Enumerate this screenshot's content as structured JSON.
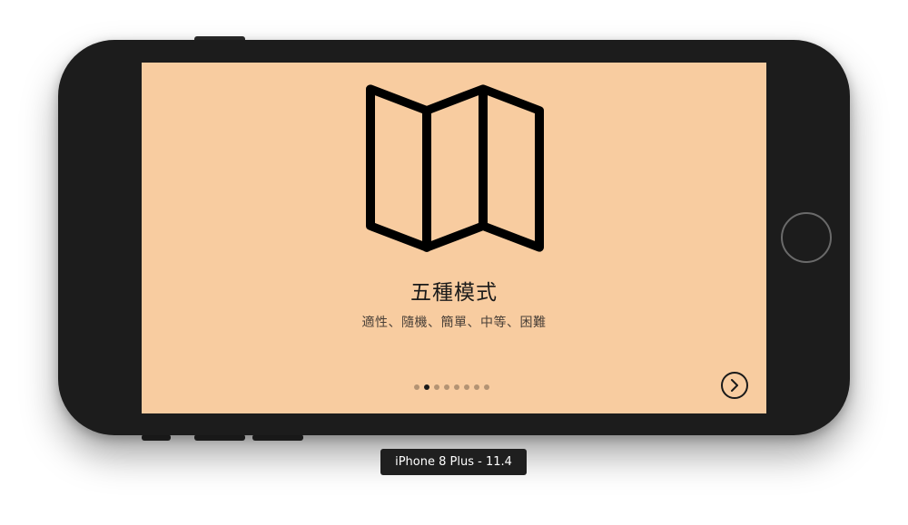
{
  "device": {
    "label": "iPhone 8 Plus - 11.4"
  },
  "onboarding": {
    "title": "五種模式",
    "subtitle": "適性、隨機、簡單、中等、困難",
    "hero_icon": "folded-map-icon",
    "page_count": 8,
    "current_page": 2,
    "next_icon": "chevron-right-circle-icon"
  },
  "colors": {
    "screen_background": "#f8cca0",
    "device_body": "#1c1c1c",
    "foreground": "#1a1a1a"
  }
}
